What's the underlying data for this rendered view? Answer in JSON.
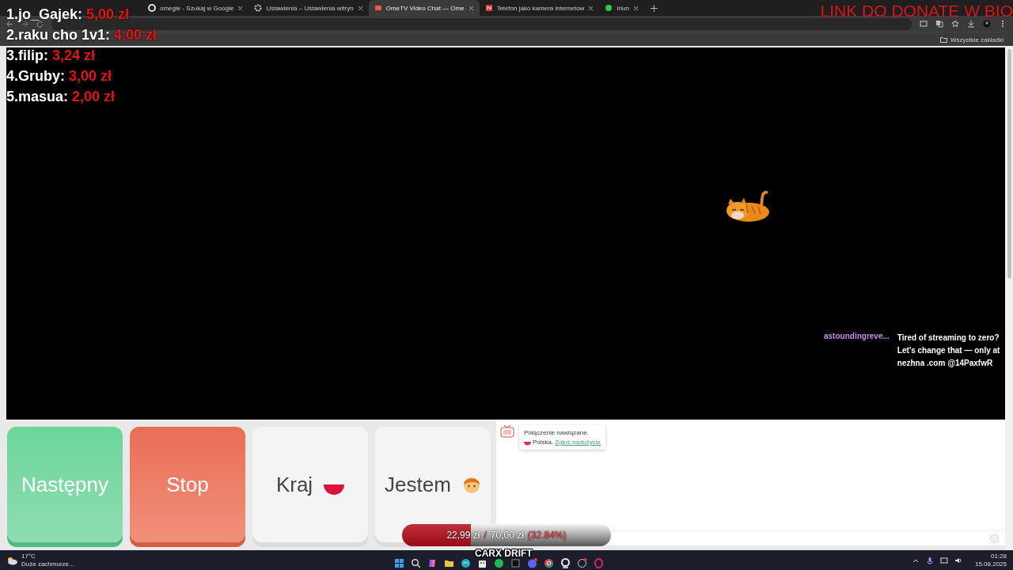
{
  "browser": {
    "tabs": [
      {
        "kind": "google",
        "title": "omegle - Szukaj w Google",
        "selected": false
      },
      {
        "kind": "gear",
        "title": "Ustawienia – Ustawienia witryn",
        "selected": false
      },
      {
        "kind": "tv",
        "title": "OmeTV Video Chat — Ome",
        "selected": true
      },
      {
        "kind": "letter",
        "title": "Telefon jako kamera internetow",
        "selected": false
      },
      {
        "kind": "dot",
        "title": "Iriun",
        "selected": false
      }
    ],
    "bookmarks": "Wszystkie zakładki"
  },
  "leaderboard": [
    {
      "rank": "1.",
      "name": "jo_Gajek:",
      "amount": "5,00 zł"
    },
    {
      "rank": "2.",
      "name": "raku cho 1v1:",
      "amount": "4,00 zł"
    },
    {
      "rank": "3.",
      "name": "filip:",
      "amount": "3,24 zł"
    },
    {
      "rank": "4.",
      "name": "Gruby:",
      "amount": "3,00 zł"
    },
    {
      "rank": "5.",
      "name": "masua:",
      "amount": "2,00 zł"
    }
  ],
  "donate_banner": "LINK DO DONATE W BIO",
  "stream_chat": {
    "user": "astoundingreve...",
    "message": "Tired of streaming to zero? Let’s change that — only at nezhna .com @14PaxfwR"
  },
  "controls": [
    {
      "kind": "next",
      "label": "Następny"
    },
    {
      "kind": "stop",
      "label": "Stop"
    },
    {
      "kind": "country",
      "label": "Kraj"
    },
    {
      "kind": "gender",
      "label": "Jestem"
    }
  ],
  "chat": {
    "status": "Połączenie nawiązane.",
    "country": "Polska.",
    "report_link": "Zgłoś nadużycie"
  },
  "goal": {
    "current": "22,99 zł",
    "separator": "/",
    "target": "70,00 zł",
    "percent": "(32.84%)",
    "level": 0.3284
  },
  "game_label": "CARX DRIFT",
  "taskbar": {
    "temperature": "17°C",
    "weather": "Duże zachmurze...",
    "time": "01:28",
    "date": "15.08.2025"
  }
}
